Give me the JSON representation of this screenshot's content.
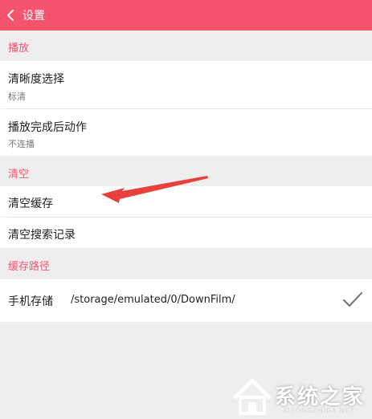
{
  "header": {
    "title": "设置",
    "back_icon": "chevron-left-icon",
    "color": "#f5546f"
  },
  "sections": {
    "playback": {
      "title": "播放",
      "clarity_label": "清晰度选择",
      "clarity_value": "标清",
      "after_play_label": "播放完成后动作",
      "after_play_value": "不连播"
    },
    "clear": {
      "title": "清空",
      "clear_cache_label": "清空缓存",
      "clear_search_label": "清空搜索记录"
    },
    "cache_path": {
      "title": "缓存路径",
      "storage_label": "手机存储",
      "storage_path": "/storage/emulated/0/DownFilm/",
      "selected_icon": "checkmark-icon"
    }
  },
  "annotation": {
    "arrow_color": "#e8403c",
    "arrow_icon": "arrow-left-icon"
  },
  "watermark": {
    "text": "系统之家",
    "sub": "XITONGZHIJIA.NET"
  }
}
